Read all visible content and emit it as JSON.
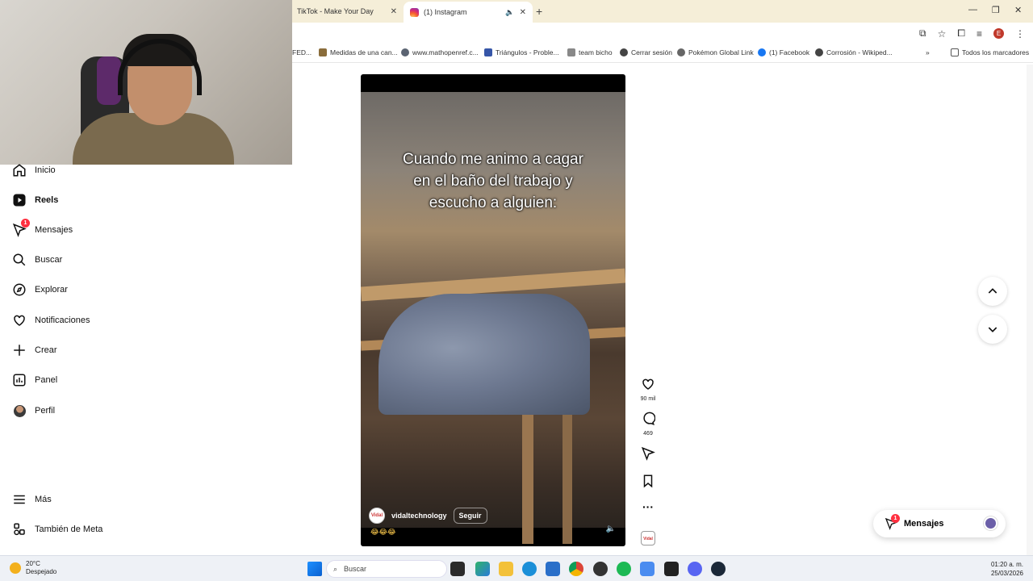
{
  "browser": {
    "tabs": [
      {
        "label": "TikTok - Make Your Day"
      },
      {
        "label": "(1) Instagram"
      }
    ],
    "bookmarks": [
      {
        "label": "FED..."
      },
      {
        "label": "Medidas de una can..."
      },
      {
        "label": "www.mathopenref.c..."
      },
      {
        "label": "Triángulos - Proble..."
      },
      {
        "label": "team bicho"
      },
      {
        "label": "Cerrar sesión"
      },
      {
        "label": "Pokémon Global Link"
      },
      {
        "label": "(1) Facebook"
      },
      {
        "label": "Corrosión - Wikiped..."
      },
      {
        "label": "Todos los marcadores"
      }
    ],
    "profile_initial": "E"
  },
  "sidebar": {
    "items": [
      {
        "label": "Inicio",
        "icon": "home-icon"
      },
      {
        "label": "Reels",
        "icon": "reels-icon"
      },
      {
        "label": "Mensajes",
        "icon": "messenger-icon",
        "badge": "1"
      },
      {
        "label": "Buscar",
        "icon": "search-icon"
      },
      {
        "label": "Explorar",
        "icon": "compass-icon"
      },
      {
        "label": "Notificaciones",
        "icon": "heart-icon"
      },
      {
        "label": "Crear",
        "icon": "plus-icon"
      },
      {
        "label": "Panel",
        "icon": "dashboard-icon"
      },
      {
        "label": "Perfil",
        "icon": "avatar"
      },
      {
        "label": "Más",
        "icon": "menu-icon"
      },
      {
        "label": "También de Meta",
        "icon": "meta-icon"
      }
    ]
  },
  "reel": {
    "caption_lines": [
      "Cuando me animo a cagar",
      "en el baño del trabajo y",
      "escucho a alguien:"
    ],
    "author": "vidaltechnology",
    "follow_label": "Seguir",
    "emojis": "😂😂😂",
    "likes": "90 mil",
    "comments": "469"
  },
  "messages_pill": {
    "label": "Mensajes",
    "badge": "1"
  },
  "taskbar": {
    "weather_temp": "20°C",
    "weather_desc": "Despejado",
    "search_placeholder": "Buscar",
    "time": "01:20 a. m.",
    "date": "25/03/2026"
  },
  "colors": {
    "badge": "#ff3040",
    "tabstrip": "#f5eed8",
    "taskbar": "#eef1f6"
  }
}
